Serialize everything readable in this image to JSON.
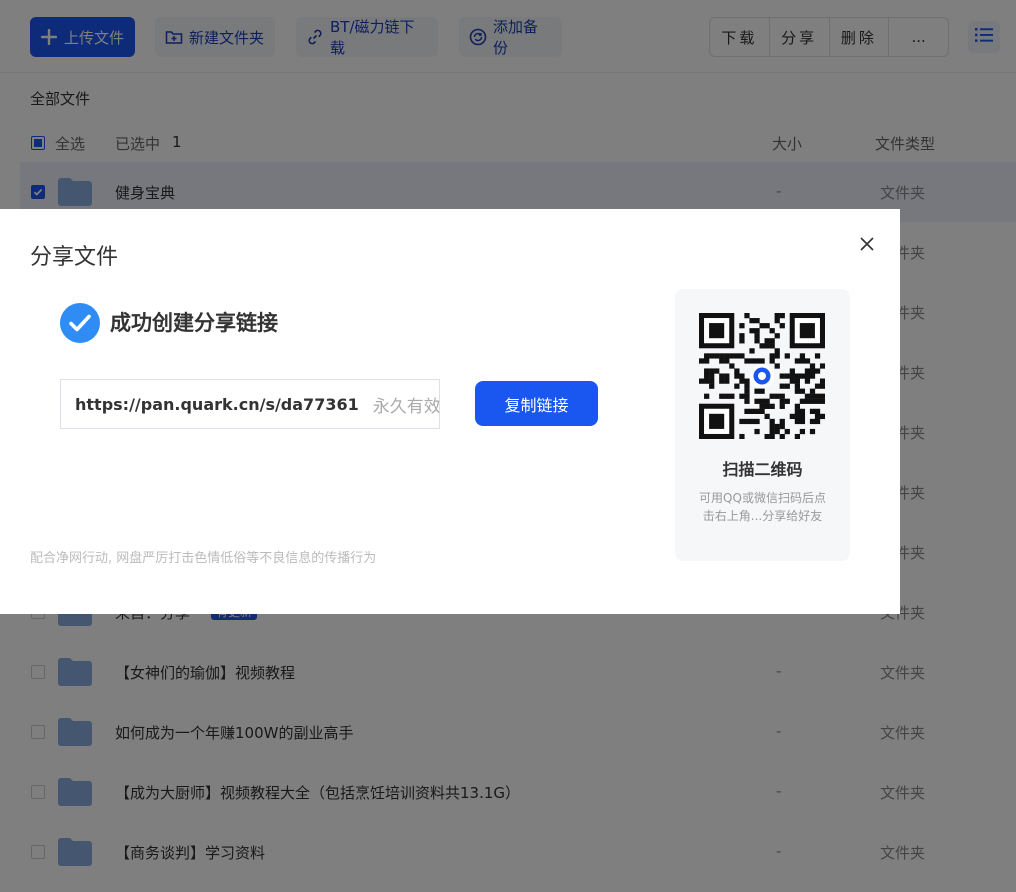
{
  "toolbar": {
    "upload_label": "上传文件",
    "new_folder_label": "新建文件夹",
    "bt_label": "BT/磁力链下载",
    "backup_label": "添加备份",
    "download_label": "下载",
    "share_label": "分享",
    "delete_label": "删除",
    "more_label": "..."
  },
  "breadcrumb": "全部文件",
  "list_header": {
    "select_all": "全选",
    "selected_prefix": "已选中",
    "selected_count": "1",
    "size_col": "大小",
    "type_col": "文件类型"
  },
  "files": [
    {
      "name": "健身宝典",
      "size": "-",
      "type": "文件夹",
      "selected": true
    },
    {
      "name": "",
      "size": "-",
      "type": "文件夹"
    },
    {
      "name": "",
      "size": "-",
      "type": "文件夹"
    },
    {
      "name": "",
      "size": "-",
      "type": "文件夹"
    },
    {
      "name": "",
      "size": "-",
      "type": "文件夹"
    },
    {
      "name": "",
      "size": "-",
      "type": "文件夹"
    },
    {
      "name": "",
      "size": "-",
      "type": "文件夹"
    },
    {
      "name": "来自：分享",
      "badge": "有更新",
      "size": "-",
      "type": "文件夹"
    },
    {
      "name": "【女神们的瑜伽】视频教程",
      "size": "-",
      "type": "文件夹"
    },
    {
      "name": "如何成为一个年赚100W的副业高手",
      "size": "-",
      "type": "文件夹"
    },
    {
      "name": "【成为大厨师】视频教程大全（包括烹饪培训资料共13.1G）",
      "size": "-",
      "type": "文件夹"
    },
    {
      "name": "【商务谈判】学习资料",
      "size": "-",
      "type": "文件夹"
    }
  ],
  "share_modal": {
    "title": "分享文件",
    "success_text": "成功创建分享链接",
    "link_url": "https://pan.quark.cn/s/da77361",
    "link_expiry": "永久有效",
    "copy_button": "复制链接",
    "notice": "配合净网行动, 网盘严厉打击色情低俗等不良信息的传播行为",
    "qr_title": "扫描二维码",
    "qr_desc": "可用QQ或微信扫码后点击右上角...分享给好友"
  },
  "colors": {
    "primary": "#1a56f0",
    "success": "#2f8cf5",
    "folder": "#8aaee0"
  }
}
